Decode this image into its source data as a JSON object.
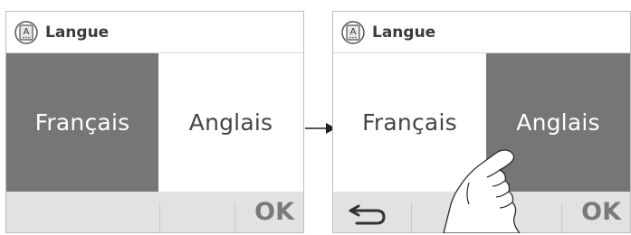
{
  "screens": [
    {
      "header": {
        "icon": "language-icon",
        "icon_letter": "A",
        "title": "Langue"
      },
      "options": [
        {
          "label": "Français",
          "selected": true
        },
        {
          "label": "Anglais",
          "selected": false
        }
      ],
      "ok_label": "OK"
    },
    {
      "header": {
        "icon": "language-icon",
        "icon_letter": "A",
        "title": "Langue"
      },
      "options": [
        {
          "label": "Français",
          "selected": false
        },
        {
          "label": "Anglais",
          "selected": true
        }
      ],
      "back_icon": "back-arrow-icon",
      "ok_label": "OK"
    }
  ],
  "colors": {
    "selected_bg": "#767676",
    "selected_text": "#ffffff",
    "unselected_text": "#454545",
    "bottom_bar": "#e2e2e2",
    "ok_text": "#7a7a7a"
  },
  "transition_icon": "arrow-right-icon",
  "gesture_icon": "tap-hand-icon"
}
